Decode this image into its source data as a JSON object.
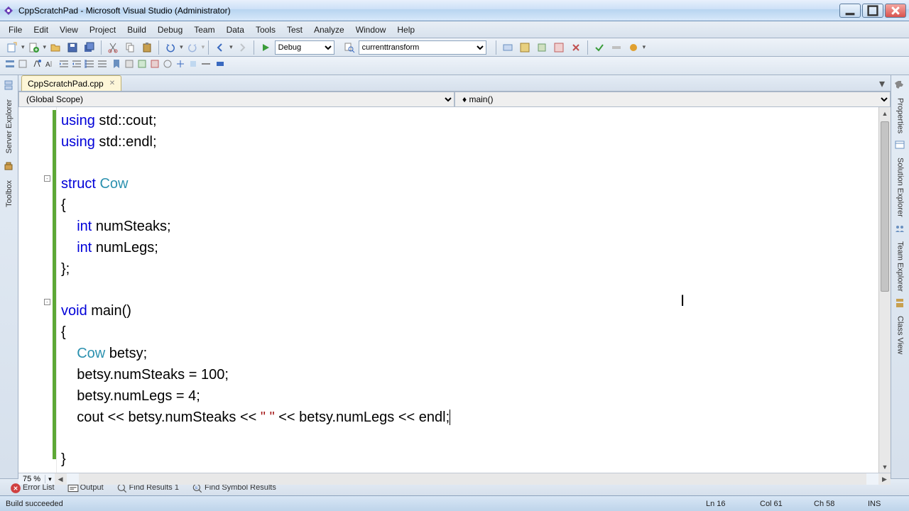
{
  "window": {
    "title": "CppScratchPad - Microsoft Visual Studio (Administrator)"
  },
  "menu": {
    "file": "File",
    "edit": "Edit",
    "view": "View",
    "project": "Project",
    "build": "Build",
    "debug": "Debug",
    "team": "Team",
    "data": "Data",
    "tools": "Tools",
    "test": "Test",
    "analyze": "Analyze",
    "window": "Window",
    "help": "Help"
  },
  "toolbar": {
    "config": "Debug",
    "transform": "currenttransform"
  },
  "leftrail": {
    "server_explorer": "Server Explorer",
    "toolbox": "Toolbox"
  },
  "rightrail": {
    "properties": "Properties",
    "solution_explorer": "Solution Explorer",
    "team_explorer": "Team Explorer",
    "class_view": "Class View"
  },
  "tab": {
    "name": "CppScratchPad.cpp"
  },
  "nav": {
    "scope": "(Global Scope)",
    "member": "main()"
  },
  "code": {
    "l1a": "using",
    "l1b": " std::cout;",
    "l2a": "using",
    "l2b": " std::endl;",
    "l4a": "struct",
    "l4b": " ",
    "l4c": "Cow",
    "l5": "{",
    "l6a": "    ",
    "l6b": "int",
    "l6c": " numSteaks;",
    "l7a": "    ",
    "l7b": "int",
    "l7c": " numLegs;",
    "l8": "};",
    "l10a": "void",
    "l10b": " main()",
    "l11": "{",
    "l12a": "    ",
    "l12b": "Cow",
    "l12c": " betsy;",
    "l13": "    betsy.numSteaks = 100;",
    "l14": "    betsy.numLegs = 4;",
    "l15a": "    cout << betsy.numSteaks << ",
    "l15b": "\" \"",
    "l15c": " << betsy.numLegs << endl;",
    "l17": "}"
  },
  "zoom": "75 %",
  "bottom": {
    "error_list": "Error List",
    "output": "Output",
    "find1": "Find Results 1",
    "find_symbol": "Find Symbol Results"
  },
  "status": {
    "message": "Build succeeded",
    "ln": "Ln 16",
    "col": "Col 61",
    "ch": "Ch 58",
    "ins": "INS"
  }
}
